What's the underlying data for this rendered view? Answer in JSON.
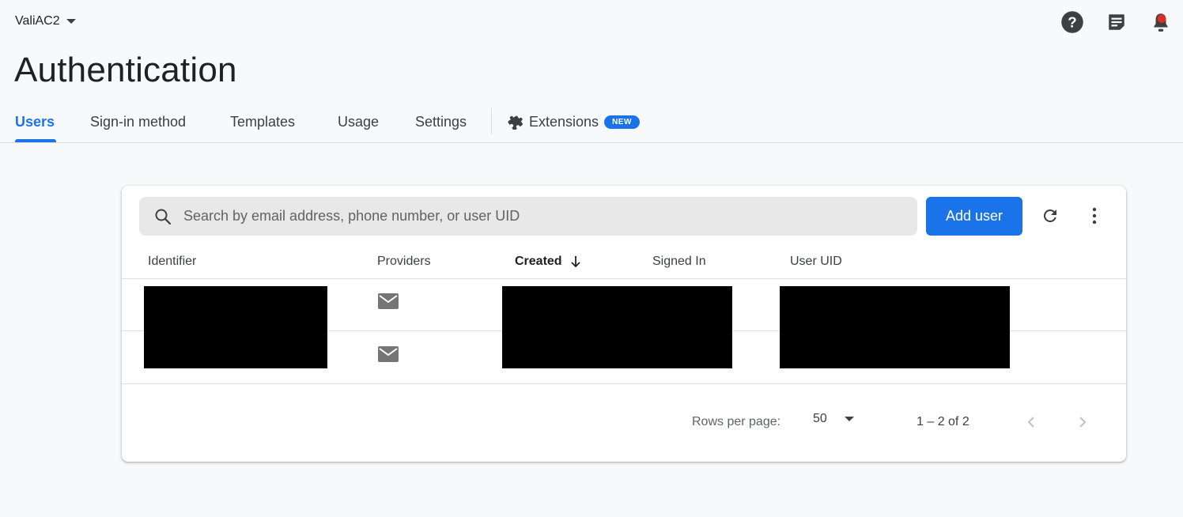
{
  "project": {
    "name": "ValiAC2"
  },
  "header_icons": [
    "help-icon",
    "feedback-icon",
    "notifications-icon"
  ],
  "page": {
    "title": "Authentication"
  },
  "tabs": [
    {
      "label": "Users",
      "active": true
    },
    {
      "label": "Sign-in method"
    },
    {
      "label": "Templates"
    },
    {
      "label": "Usage"
    },
    {
      "label": "Settings"
    },
    {
      "label": "Extensions",
      "badge": "NEW"
    }
  ],
  "search": {
    "placeholder": "Search by email address, phone number, or user UID",
    "value": ""
  },
  "toolbar": {
    "add_user_label": "Add user"
  },
  "table": {
    "columns": [
      "Identifier",
      "Providers",
      "Created",
      "Signed In",
      "User UID"
    ],
    "sort": {
      "column": "Created",
      "direction": "descending"
    },
    "rows": [
      {
        "identifier": "",
        "provider": "email",
        "created": "",
        "signed_in": "",
        "uid": ""
      },
      {
        "identifier": "",
        "provider": "email",
        "created": "",
        "signed_in": "",
        "uid": ""
      }
    ]
  },
  "pagination": {
    "rows_per_page_label": "Rows per page:",
    "rows_per_page": "50",
    "range": "1 – 2 of 2"
  },
  "colors": {
    "accent": "#1a73e8",
    "notification_dot": "#d93025"
  }
}
